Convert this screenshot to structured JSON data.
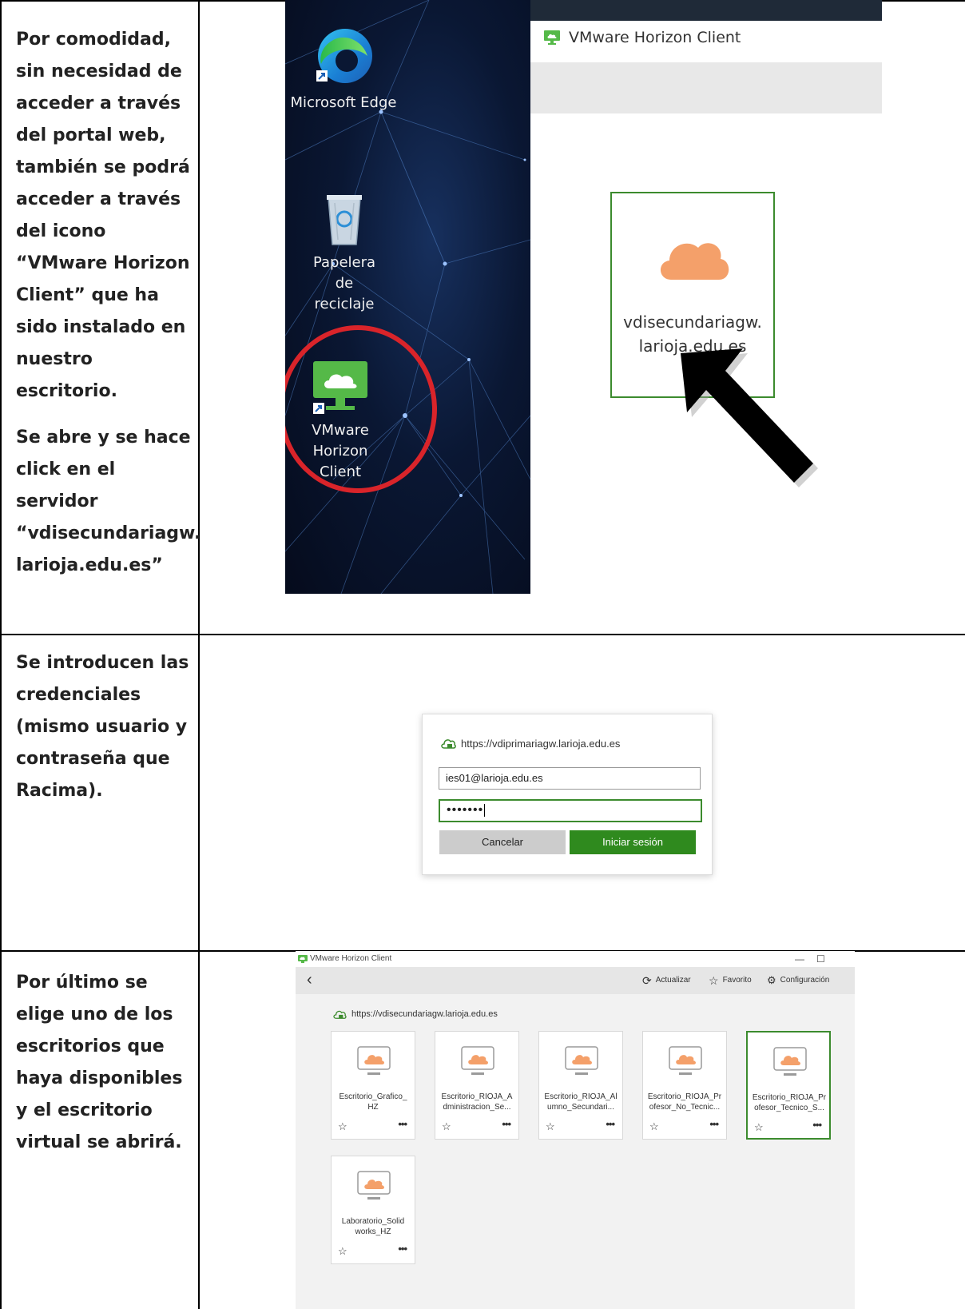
{
  "row1": {
    "paragraphs": [
      "Por comodidad, sin necesidad de acceder a través del portal web, también se podrá acceder a través del icono “VMware Horizon Client” que ha sido instalado en nuestro escritorio.",
      "Se abre y se hace click en el servidor “vdisecundariagw. larioja.edu.es”"
    ],
    "desktop_icons": {
      "edge": "Microsoft Edge",
      "recycle": "Papelera de reciclaje",
      "horizon": "VMware Horizon Client"
    },
    "window_title": "VMware Horizon Client",
    "server_name": "vdisecundariagw. larioja.edu.es"
  },
  "row2": {
    "text": "Se introducen las credenciales (mismo usuario y contraseña que Racima).",
    "login": {
      "url": "https://vdiprimariagw.larioja.edu.es",
      "username": "ies01@larioja.edu.es",
      "password_mask": "•••••••",
      "cancel_label": "Cancelar",
      "signin_label": "Iniciar sesión"
    }
  },
  "row3": {
    "text": "Por último se elige uno de los escritorios que haya disponibles y el escritorio virtual se abrirá.",
    "window_title": "VMware Horizon Client",
    "toolbar": {
      "refresh": "Actualizar",
      "favorite": "Favorito",
      "settings": "Configuración"
    },
    "server_url": "https://vdisecundariagw.larioja.edu.es",
    "desktops": [
      "Escritorio_Grafico_ HZ",
      "Escritorio_RIOJA_A dministracion_Se...",
      "Escritorio_RIOJA_Al umno_Secundari...",
      "Escritorio_RIOJA_Pr ofesor_No_Tecnic...",
      "Escritorio_RIOJA_Pr ofesor_Tecnico_S...",
      "Laboratorio_Solid works_HZ"
    ],
    "selected_desktop_index": 4
  },
  "colors": {
    "green": "#3c8b2e",
    "button_green": "#2f8a1e",
    "cloud_orange": "#f4a06a",
    "red_ring": "#d9242a"
  }
}
